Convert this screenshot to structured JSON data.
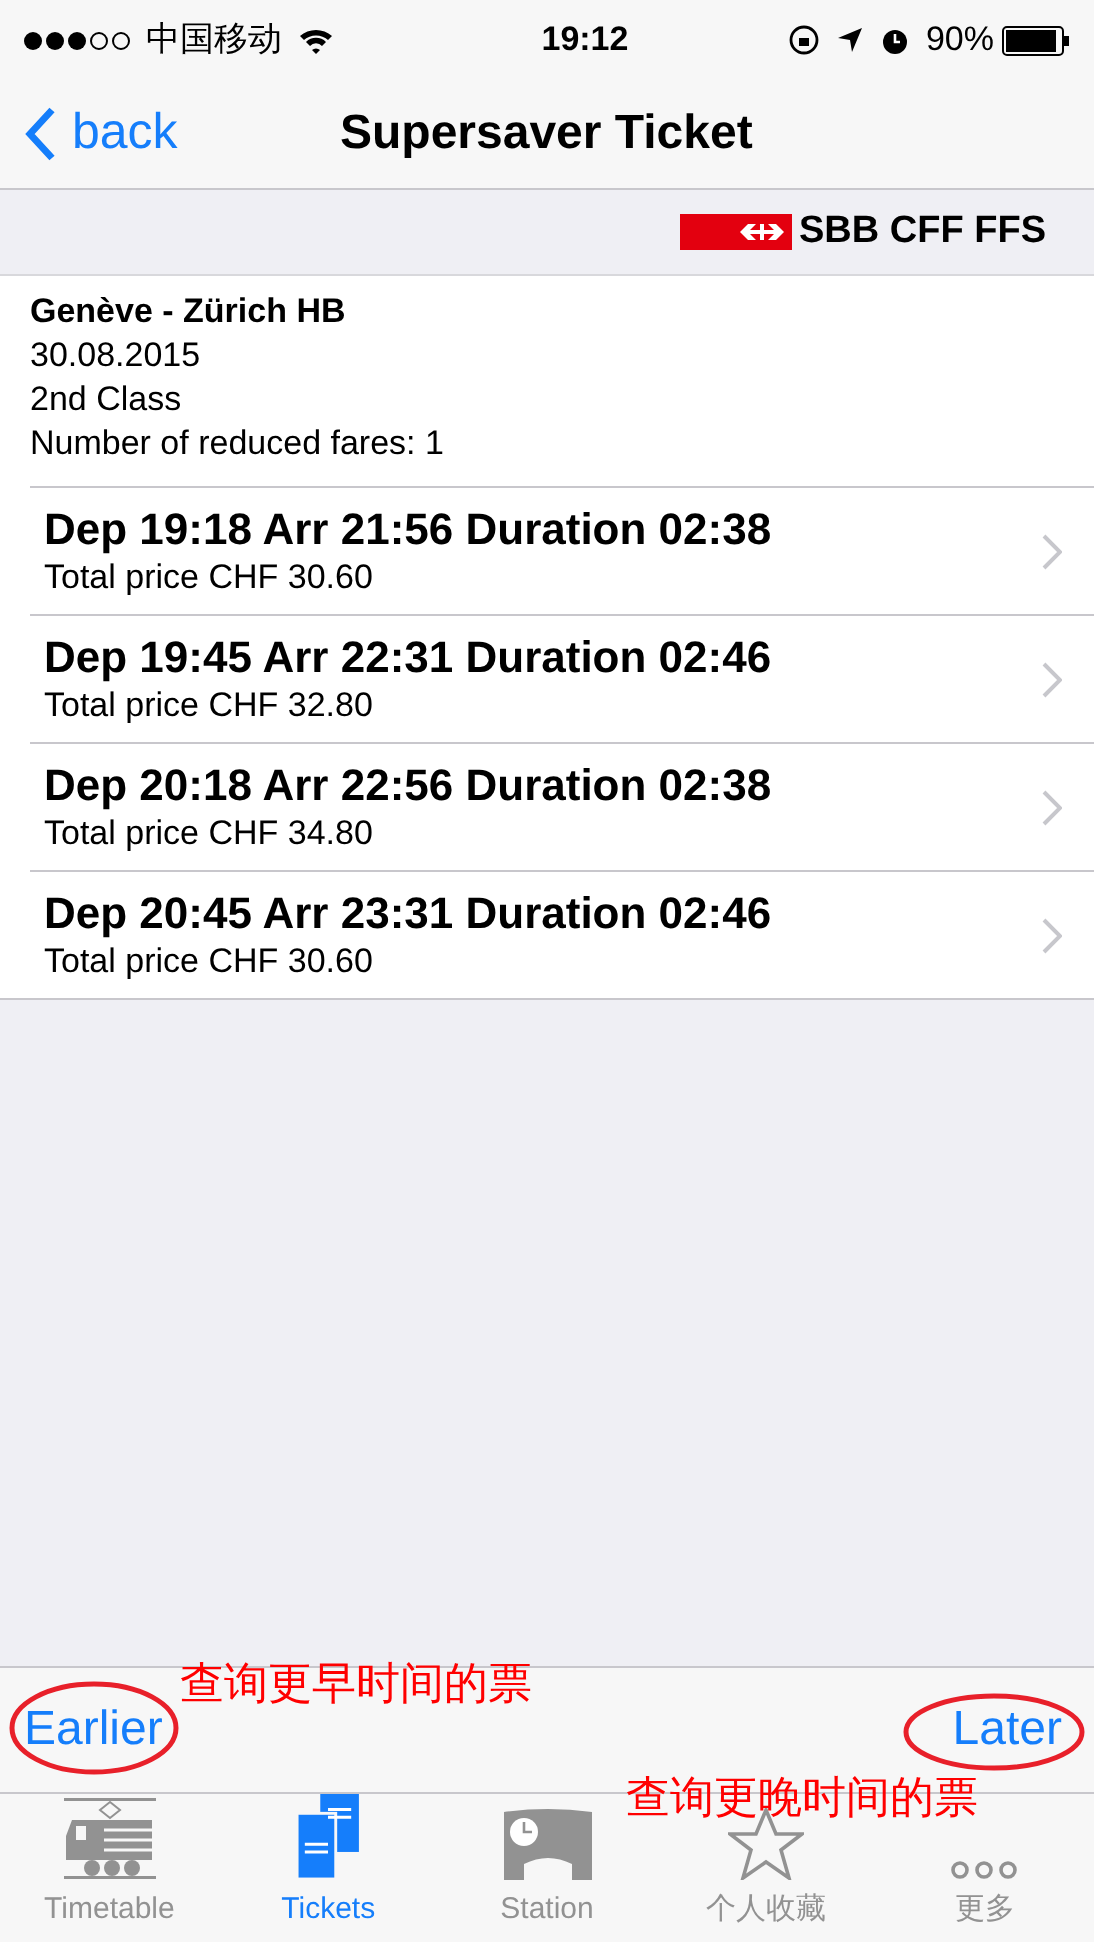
{
  "status_bar": {
    "carrier": "中国移动",
    "time": "19:12",
    "battery": "90%"
  },
  "nav": {
    "back": "back",
    "title": "Supersaver Ticket"
  },
  "logo": {
    "text": "SBB CFF FFS"
  },
  "summary": [
    "Genève - Zürich HB",
    "30.08.2015",
    "2nd Class",
    "Number of reduced fares: 1"
  ],
  "connections": [
    {
      "title": "Dep 19:18 Arr 21:56 Duration 02:38",
      "price": "Total price CHF 30.60"
    },
    {
      "title": "Dep 19:45 Arr 22:31 Duration 02:46",
      "price": "Total price CHF 32.80"
    },
    {
      "title": "Dep 20:18 Arr 22:56 Duration 02:38",
      "price": "Total price CHF 34.80"
    },
    {
      "title": "Dep 20:45 Arr 23:31 Duration 02:46",
      "price": "Total price CHF 30.60"
    }
  ],
  "toolbar": {
    "earlier": "Earlier",
    "later": "Later"
  },
  "annotations": [
    "查询更早时间的票",
    "查询更晚时间的票"
  ],
  "tabs": [
    {
      "kind": "train",
      "label": "Timetable",
      "selected": false
    },
    {
      "kind": "tickets",
      "label": "Tickets",
      "selected": true
    },
    {
      "kind": "station",
      "label": "Station",
      "selected": false
    },
    {
      "kind": "star",
      "label": "个人收藏",
      "selected": false
    },
    {
      "kind": "more",
      "label": "更多",
      "selected": false
    }
  ]
}
